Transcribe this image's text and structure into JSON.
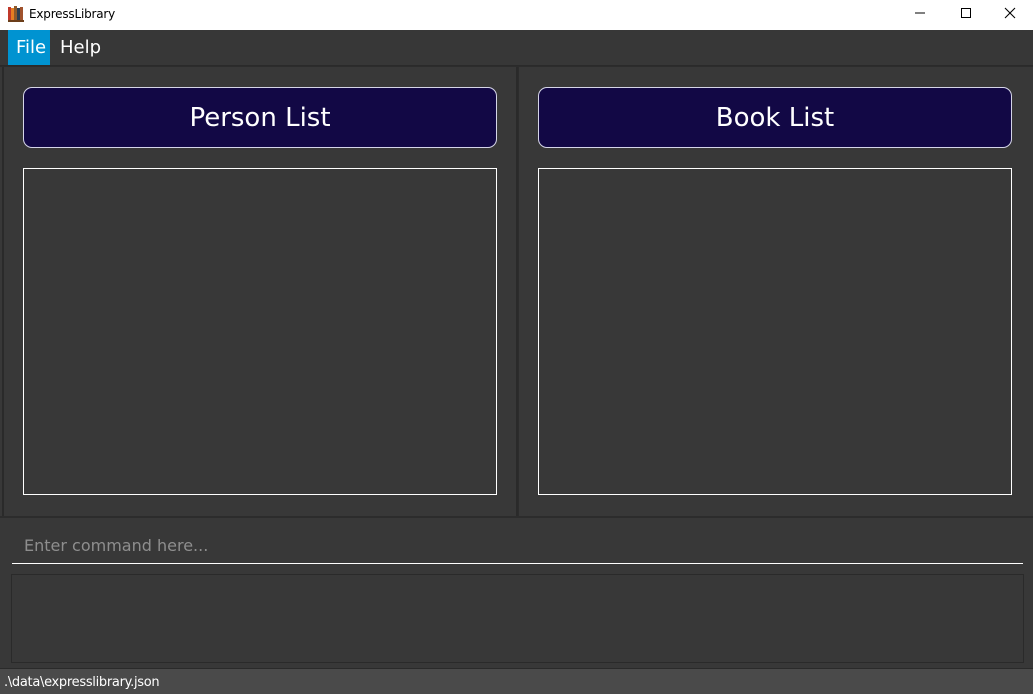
{
  "window": {
    "title": "ExpressLibrary",
    "icon": "books-icon",
    "controls": [
      "minimize-icon",
      "maximize-icon",
      "close-icon"
    ]
  },
  "menu": {
    "items": [
      {
        "label": "File",
        "selected": true
      },
      {
        "label": "Help",
        "selected": false
      }
    ]
  },
  "panels": {
    "person_list": {
      "title": "Person List",
      "items": []
    },
    "book_list": {
      "title": "Book List",
      "items": []
    }
  },
  "command": {
    "placeholder": "Enter command here...",
    "value": ""
  },
  "result": {
    "text": ""
  },
  "status": {
    "path": ".\\data\\expresslibrary.json"
  },
  "colors": {
    "background": "#383838",
    "header_bg": "#120845",
    "menu_selected": "#0093d1",
    "statusbar": "#4a4a4a"
  }
}
